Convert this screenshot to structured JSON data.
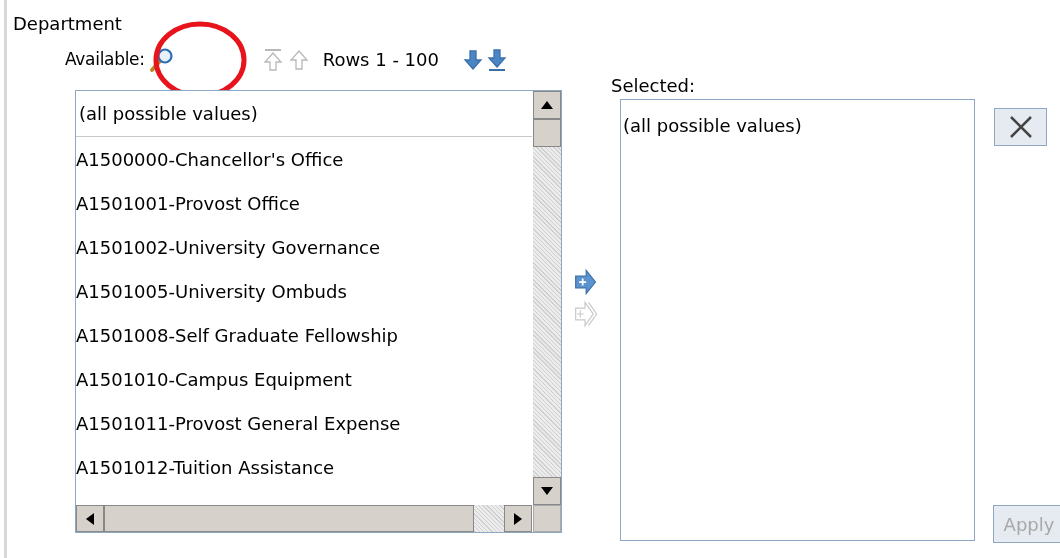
{
  "title": "Department",
  "available": {
    "label": "Available:",
    "rows": "Rows 1 - 100",
    "nav": [
      {
        "kind": "first",
        "disabled": true
      },
      {
        "kind": "previous",
        "disabled": true
      },
      {
        "kind": "next",
        "disabled": false
      },
      {
        "kind": "last",
        "disabled": false
      }
    ],
    "items": [
      {
        "text": "(all possible values)",
        "kind": "all"
      },
      {
        "text": "A1500000-Chancellor's Office",
        "kind": "value"
      },
      {
        "text": "A1501001-Provost Office",
        "kind": "value"
      },
      {
        "text": "A1501002-University Governance",
        "kind": "value"
      },
      {
        "text": "A1501005-University Ombuds",
        "kind": "value"
      },
      {
        "text": "A1501008-Self Graduate Fellowship",
        "kind": "value"
      },
      {
        "text": "A1501010-Campus Equipment",
        "kind": "value"
      },
      {
        "text": "A1501011-Provost General Expense",
        "kind": "value"
      },
      {
        "text": "A1501012-Tuition Assistance",
        "kind": "value"
      }
    ]
  },
  "move_buttons": [
    {
      "kind": "add",
      "disabled": false
    },
    {
      "kind": "add_all",
      "disabled": true
    }
  ],
  "selected": {
    "label": "Selected:",
    "items": [
      "(all possible values)"
    ]
  },
  "remove_button": {
    "disabled": false
  },
  "apply_button": {
    "label": "Apply",
    "disabled": true
  }
}
